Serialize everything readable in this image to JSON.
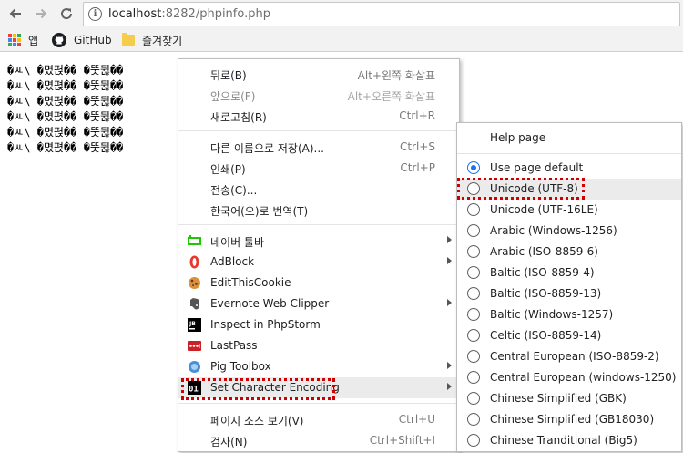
{
  "browser": {
    "url_host": "localhost",
    "url_rest": ":8282/phpinfo.php",
    "info_glyph": "i",
    "icons": {
      "back": "arrow-left-icon",
      "forward": "arrow-right-icon",
      "reload": "reload-icon",
      "site_info": "info-icon"
    }
  },
  "bookmarks": [
    {
      "label": "앱",
      "icon": "apps-grid-icon"
    },
    {
      "label": "GitHub",
      "icon": "github-icon"
    },
    {
      "label": "즐겨찾기",
      "icon": "folder-icon"
    }
  ],
  "page": {
    "garbled_lines": [
      "�ㅻ\\ �몄펹�� �뚯뒪��",
      "�ㅻ\\ �몄펹�� �뚯뒪��",
      "�ㅻ\\ �몄펹�� �뚯뒪��",
      "�ㅻ\\ �몄펹�� �뚯뒪��",
      "�ㅻ\\ �몄펹�� �뚯뒪��",
      "�ㅻ\\ �몄펹�� �뚯뒪��"
    ]
  },
  "context_menu": {
    "items": [
      {
        "label": "뒤로(B)",
        "shortcut": "Alt+왼쪽 화살표"
      },
      {
        "label": "앞으로(F)",
        "shortcut": "Alt+오른쪽 화살표",
        "disabled": true
      },
      {
        "label": "새로고침(R)",
        "shortcut": "Ctrl+R"
      },
      {
        "label": "다른 이름으로 저장(A)...",
        "shortcut": "Ctrl+S"
      },
      {
        "label": "인쇄(P)",
        "shortcut": "Ctrl+P"
      },
      {
        "label": "전송(C)...",
        "shortcut": ""
      },
      {
        "label": "한국어(으)로 번역(T)",
        "shortcut": ""
      },
      {
        "label": "네이버 툴바",
        "icon": "naver-toolbar-icon",
        "submenu": true
      },
      {
        "label": "AdBlock",
        "icon": "adblock-icon",
        "submenu": true
      },
      {
        "label": "EditThisCookie",
        "icon": "cookie-icon"
      },
      {
        "label": "Evernote Web Clipper",
        "icon": "evernote-icon",
        "submenu": true
      },
      {
        "label": "Inspect in PhpStorm",
        "icon": "phpstorm-icon"
      },
      {
        "label": "LastPass",
        "icon": "lastpass-icon"
      },
      {
        "label": "Pig Toolbox",
        "icon": "pig-toolbox-icon",
        "submenu": true
      },
      {
        "label": "Set Character Encoding",
        "icon": "encoding-icon",
        "submenu": true,
        "icon_text": "01"
      },
      {
        "label": "페이지 소스 보기(V)",
        "shortcut": "Ctrl+U"
      },
      {
        "label": "검사(N)",
        "shortcut": "Ctrl+Shift+I"
      }
    ]
  },
  "encoding_menu": {
    "help": "Help page",
    "options": [
      {
        "label": "Use page default",
        "checked": true
      },
      {
        "label": "Unicode (UTF-8)"
      },
      {
        "label": "Unicode (UTF-16LE)"
      },
      {
        "label": "Arabic (Windows-1256)"
      },
      {
        "label": "Arabic (ISO-8859-6)"
      },
      {
        "label": "Baltic (ISO-8859-4)"
      },
      {
        "label": "Baltic (ISO-8859-13)"
      },
      {
        "label": "Baltic (Windows-1257)"
      },
      {
        "label": "Celtic (ISO-8859-14)"
      },
      {
        "label": "Central European (ISO-8859-2)"
      },
      {
        "label": "Central European (windows-1250)"
      },
      {
        "label": "Chinese Simplified (GBK)"
      },
      {
        "label": "Chinese Simplified (GB18030)"
      },
      {
        "label": "Chinese Tranditional (Big5)"
      }
    ]
  },
  "colors": {
    "highlight_outline": "#d00000",
    "radio_checked": "#1a73e8",
    "menu_hover": "#ebebeb"
  }
}
